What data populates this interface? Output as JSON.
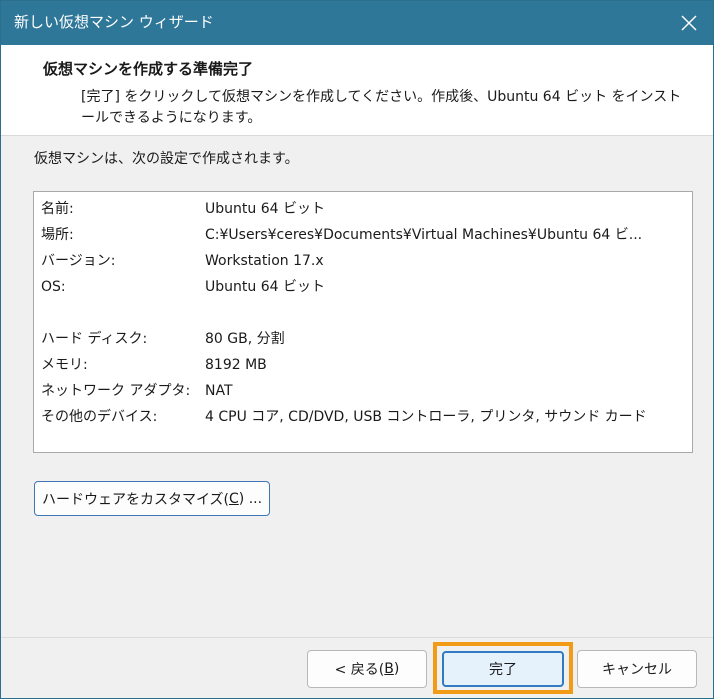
{
  "window": {
    "title": "新しい仮想マシン ウィザード"
  },
  "header": {
    "title": "仮想マシンを作成する準備完了",
    "description": "[完了] をクリックして仮想マシンを作成してください。作成後、Ubuntu 64 ビット をインストールできるようになります。"
  },
  "intro": "仮想マシンは、次の設定で作成されます。",
  "summary": {
    "rows": [
      {
        "label": "名前:",
        "value": "Ubuntu 64 ビット"
      },
      {
        "label": "場所:",
        "value": "C:¥Users¥ceres¥Documents¥Virtual Machines¥Ubuntu 64 ビ..."
      },
      {
        "label": "バージョン:",
        "value": "Workstation 17.x"
      },
      {
        "label": "OS:",
        "value": "Ubuntu 64 ビット"
      },
      {
        "label": "ハード ディスク:",
        "value": "80 GB, 分割"
      },
      {
        "label": "メモリ:",
        "value": "8192 MB"
      },
      {
        "label": "ネットワーク アダプタ:",
        "value": "NAT"
      },
      {
        "label": "その他のデバイス:",
        "value": "4 CPU コア, CD/DVD, USB コントローラ, プリンタ, サウンド カード"
      }
    ]
  },
  "buttons": {
    "customize": {
      "prefix": "ハードウェアをカスタマイズ(",
      "key": "C",
      "suffix": ") ..."
    },
    "back": {
      "prefix": "< 戻る(",
      "key": "B",
      "suffix": ")"
    },
    "finish": "完了",
    "cancel": "キャンセル"
  },
  "colors": {
    "titlebar": "#2e7799",
    "highlight": "#f29b16",
    "default_button_border": "#2f7cc2"
  },
  "icons": {
    "close": "close-icon"
  }
}
